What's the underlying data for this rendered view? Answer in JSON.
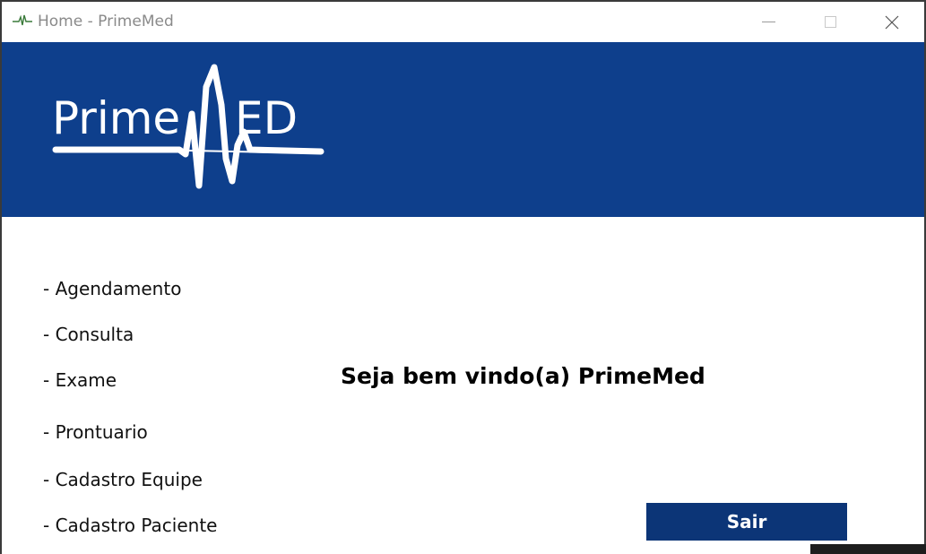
{
  "window": {
    "title": "Home - PrimeMed"
  },
  "logo": {
    "text_prime": "Prime",
    "text_ed": "ED"
  },
  "menu": {
    "items": [
      {
        "label": "- Agendamento"
      },
      {
        "label": "- Consulta"
      },
      {
        "label": "- Exame"
      },
      {
        "label": "- Prontuario"
      },
      {
        "label": "- Cadastro Equipe"
      },
      {
        "label": "- Cadastro Paciente"
      }
    ]
  },
  "main": {
    "welcome": "Seja bem vindo(a) PrimeMed",
    "exit_label": "Sair"
  },
  "colors": {
    "banner": "#0e3f8c",
    "button": "#0c3577"
  }
}
